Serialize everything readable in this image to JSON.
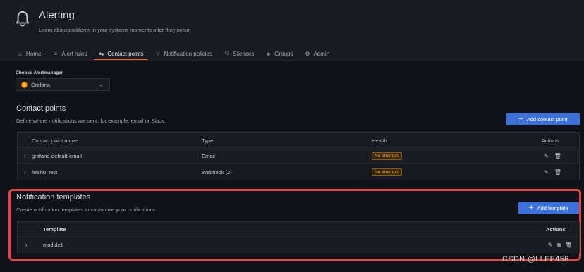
{
  "header": {
    "icon": "bell-icon",
    "title": "Alerting",
    "subtitle": "Learn about problems in your systems moments after they occur"
  },
  "tabs": [
    {
      "label": "Home",
      "icon": "home-icon",
      "active": false
    },
    {
      "label": "Alert rules",
      "icon": "list-icon",
      "active": false
    },
    {
      "label": "Contact points",
      "icon": "contact-points-icon",
      "active": true
    },
    {
      "label": "Notification policies",
      "icon": "sitemap-icon",
      "active": false
    },
    {
      "label": "Silences",
      "icon": "bell-slash-icon",
      "active": false
    },
    {
      "label": "Groups",
      "icon": "layers-icon",
      "active": false
    },
    {
      "label": "Admin",
      "icon": "cog-icon",
      "active": false
    }
  ],
  "alertmanager": {
    "label": "Choose Alertmanager",
    "selected": "Grafana"
  },
  "contact_points": {
    "title": "Contact points",
    "description": "Define where notifications are sent, for example, email or Slack.",
    "add_button": "Add contact point",
    "columns": [
      "Contact point name",
      "Type",
      "Health",
      "Actions"
    ],
    "rows": [
      {
        "name": "grafana-default-email",
        "type": "Email",
        "health": "No attempts"
      },
      {
        "name": "feishu_test",
        "type": "Webhook (2)",
        "health": "No attempts"
      }
    ]
  },
  "templates": {
    "title": "Notification templates",
    "description": "Create notification templates to customize your notifications.",
    "add_button": "Add template",
    "columns": [
      "Template",
      "Actions"
    ],
    "rows": [
      {
        "name": "module1"
      }
    ]
  },
  "colors": {
    "accent": "#f55f3e",
    "primary_button": "#3d71d9",
    "badge_text": "#f8a33e",
    "highlight_box": "#e64545"
  },
  "watermark": "CSDN @LLEE456"
}
